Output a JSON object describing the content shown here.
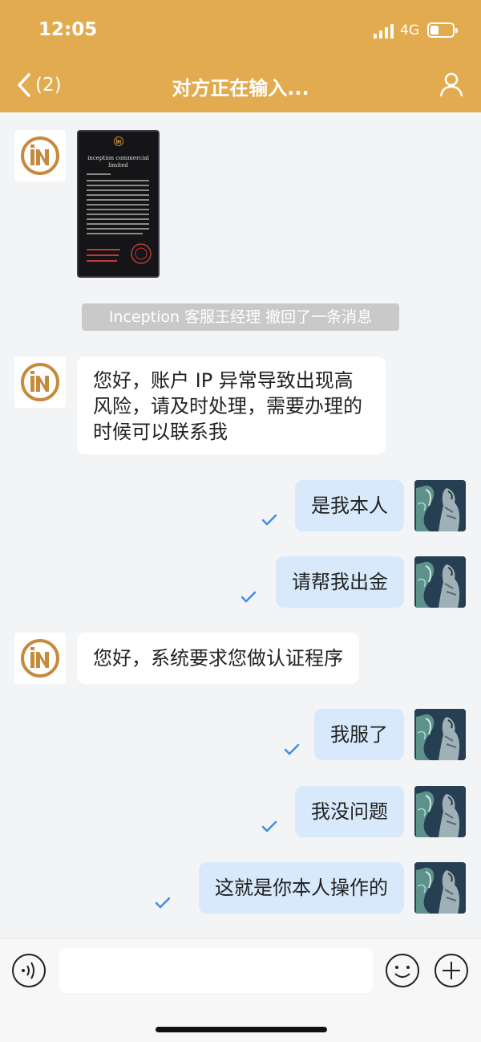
{
  "status_bar": {
    "time": "12:05",
    "network": "4G"
  },
  "nav": {
    "back_count": "(2)",
    "title": "对方正在输入..."
  },
  "image_message": {
    "company": "inception commercial limited"
  },
  "system_notice": "Inception 客服王经理 撤回了一条消息",
  "messages": [
    {
      "side": "left",
      "text": "您好，账户 IP 异常导致出现高风险，请及时处理，需要办理的时候可以联系我"
    },
    {
      "side": "right",
      "text": "是我本人"
    },
    {
      "side": "right",
      "text": "请帮我出金"
    },
    {
      "side": "left",
      "text": "您好，系统要求您做认证程序"
    },
    {
      "side": "right",
      "text": "我服了"
    },
    {
      "side": "right",
      "text": "我没问题"
    },
    {
      "side": "right",
      "text": "这就是你本人操作的"
    }
  ],
  "colors": {
    "header": "#e2ab4f",
    "self_bubble": "#d7e9fb",
    "tick": "#3f8ee8"
  },
  "icons": [
    "back-icon",
    "user-icon",
    "voice-icon",
    "emoji-icon",
    "add-icon",
    "read-tick-icon"
  ]
}
